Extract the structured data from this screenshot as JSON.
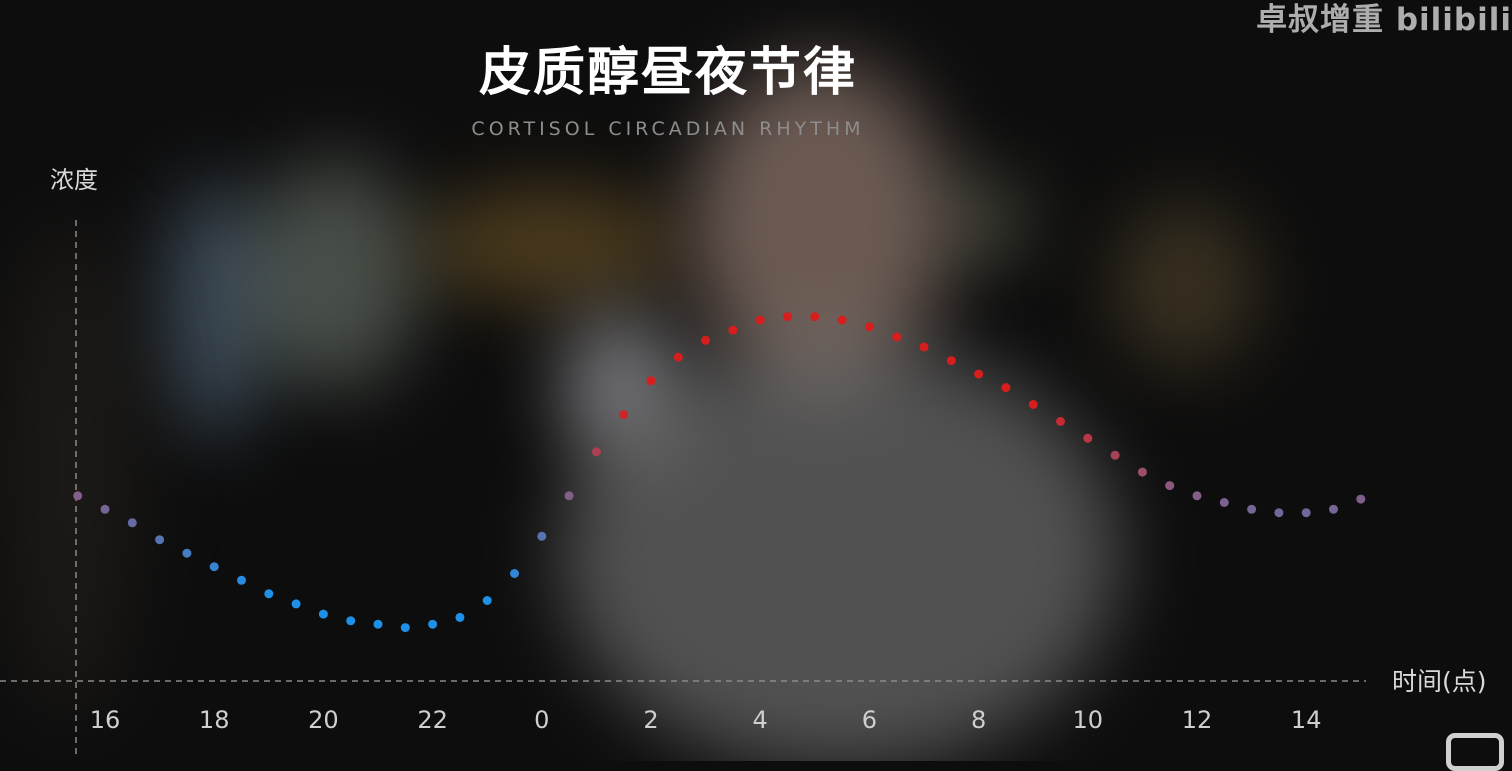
{
  "watermark": "卓叔增重 bilibili",
  "chart_data": {
    "type": "scatter",
    "title": "皮质醇昼夜节律",
    "subtitle": "CORTISOL CIRCADIAN RHYTHM",
    "ylabel": "浓度",
    "xlabel": "时间(点)",
    "x_tick_labels": [
      "16",
      "18",
      "20",
      "22",
      "0",
      "2",
      "4",
      "6",
      "8",
      "10",
      "12",
      "14"
    ],
    "grid": false,
    "colors": {
      "low": "#1e90e8",
      "high": "#d61e1e",
      "mid": "#8a5a80"
    },
    "series": [
      {
        "x": [
          15.5,
          16,
          16.5,
          17,
          17.5,
          18,
          18.5,
          19,
          19.5,
          20,
          20.5,
          21,
          21.5,
          22,
          22.5,
          23,
          23.5,
          24,
          24.5,
          25,
          25.5,
          26,
          26.5,
          27,
          27.5,
          28,
          28.5,
          29,
          29.5,
          30,
          30.5,
          31,
          31.5,
          32,
          32.5,
          33,
          33.5,
          34,
          34.5,
          35,
          35.5,
          36,
          36.5,
          37,
          37.5,
          38,
          38.5,
          39
        ],
        "y": [
          0.48,
          0.44,
          0.4,
          0.35,
          0.31,
          0.27,
          0.23,
          0.19,
          0.16,
          0.13,
          0.11,
          0.1,
          0.09,
          0.1,
          0.12,
          0.17,
          0.25,
          0.36,
          0.48,
          0.61,
          0.72,
          0.82,
          0.89,
          0.94,
          0.97,
          1.0,
          1.01,
          1.01,
          1.0,
          0.98,
          0.95,
          0.92,
          0.88,
          0.84,
          0.8,
          0.75,
          0.7,
          0.65,
          0.6,
          0.55,
          0.51,
          0.48,
          0.46,
          0.44,
          0.43,
          0.43,
          0.44,
          0.47
        ],
        "ylim": [
          0,
          1.1
        ]
      }
    ]
  }
}
